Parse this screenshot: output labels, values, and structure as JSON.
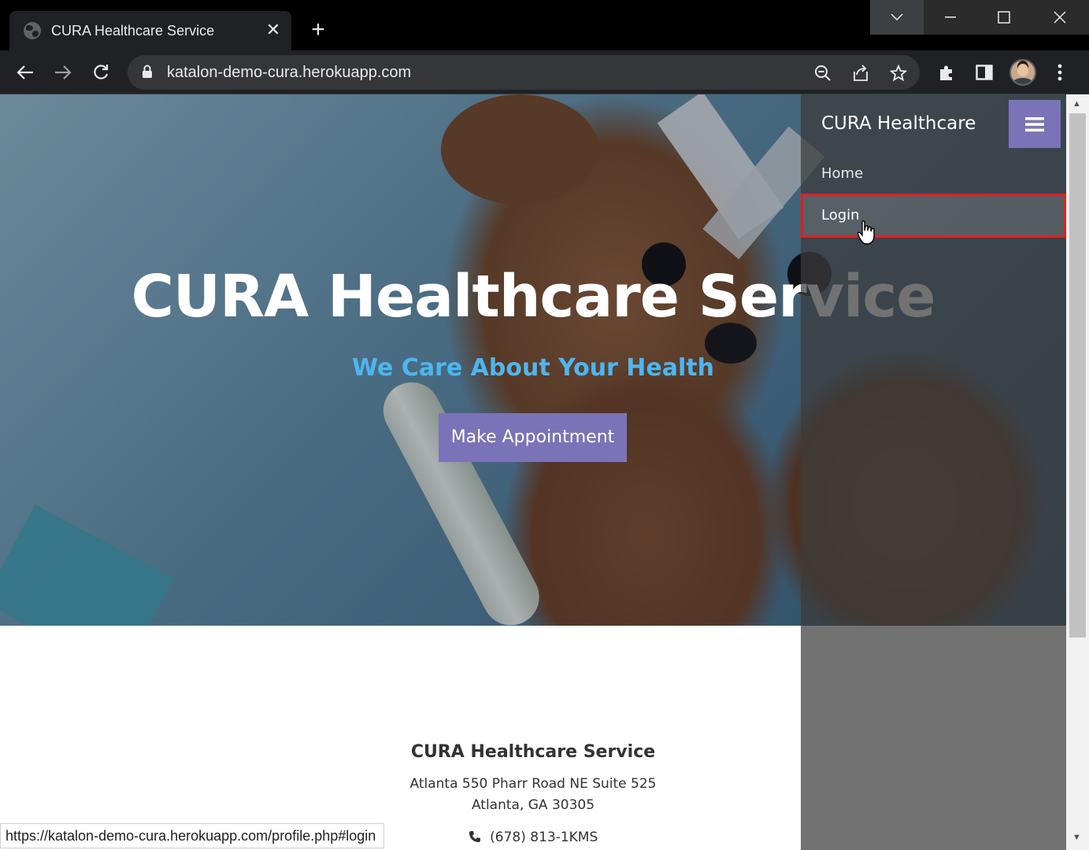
{
  "browser": {
    "tab_title": "CURA Healthcare Service",
    "url": "katalon-demo-cura.herokuapp.com",
    "status_url": "https://katalon-demo-cura.herokuapp.com/profile.php#login"
  },
  "hero": {
    "title": "CURA Healthcare Service",
    "subtitle": "We Care About Your Health",
    "button_label": "Make Appointment"
  },
  "sidebar": {
    "brand": "CURA Healthcare",
    "items": [
      {
        "label": "Home"
      },
      {
        "label": "Login"
      }
    ]
  },
  "footer": {
    "title": "CURA Healthcare Service",
    "address_line1": "Atlanta 550 Pharr Road NE Suite 525",
    "address_line2": "Atlanta, GA 30305",
    "phone": "(678) 813-1KMS"
  },
  "colors": {
    "accent": "#7b73b8",
    "subtitle": "#4db6f0",
    "highlight_border": "#e02020"
  }
}
